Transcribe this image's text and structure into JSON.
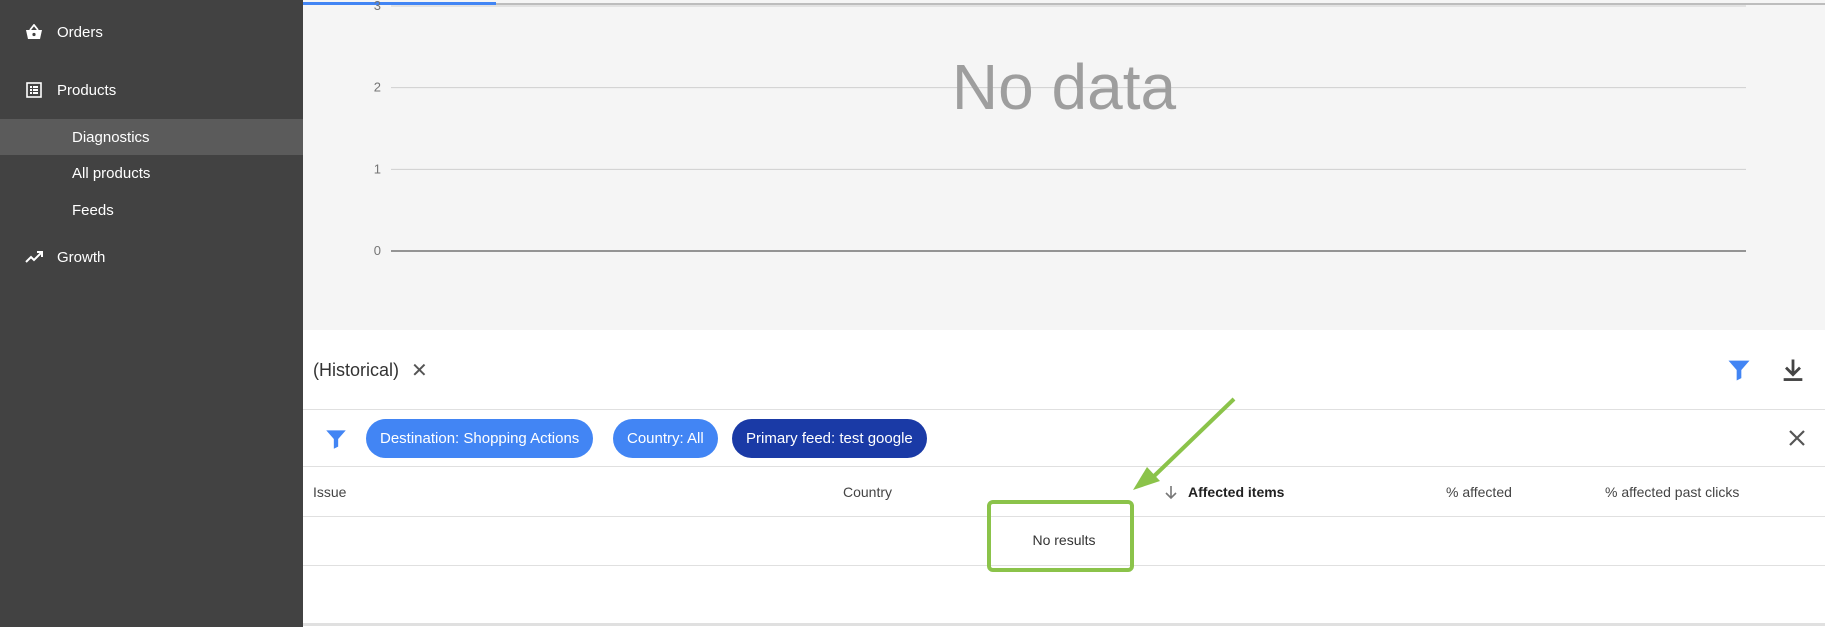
{
  "sidebar": {
    "orders": {
      "label": "Orders",
      "icon": "basket-icon"
    },
    "products": {
      "label": "Products",
      "icon": "list-icon"
    },
    "sub_items": [
      {
        "label": "Diagnostics",
        "active": true
      },
      {
        "label": "All products",
        "active": false
      },
      {
        "label": "Feeds",
        "active": false
      }
    ],
    "growth": {
      "label": "Growth",
      "icon": "trending-up-icon"
    }
  },
  "chart_data": {
    "type": "line",
    "title": "",
    "xlabel": "",
    "ylabel": "",
    "ylim": [
      0,
      3
    ],
    "yticks": [
      "3",
      "2",
      "1",
      "0"
    ],
    "series": [],
    "overlay_text": "No data"
  },
  "toolbar": {
    "title": "(Historical)",
    "close_symbol": "✕"
  },
  "filters": {
    "chips": [
      {
        "label": "Destination: Shopping Actions",
        "style": "light"
      },
      {
        "label": "Country: All",
        "style": "light"
      },
      {
        "label": "Primary feed: test google",
        "style": "dark"
      }
    ]
  },
  "table": {
    "columns": [
      "Issue",
      "Country",
      "Affected items",
      "% affected",
      "% affected past clicks"
    ],
    "sorted_column": "Affected items",
    "empty_text": "No results"
  },
  "colors": {
    "sidebar_bg": "#424242",
    "accent_blue": "#4285f4",
    "chip_dark": "#1a3aa6",
    "annotation_green": "#8bc34a"
  }
}
